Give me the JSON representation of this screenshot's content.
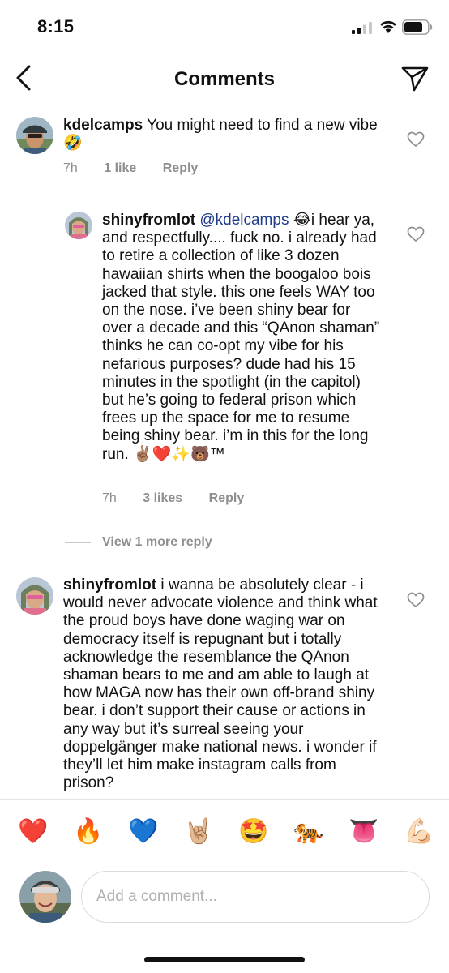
{
  "status": {
    "time": "8:15"
  },
  "header": {
    "title": "Comments"
  },
  "comments": [
    {
      "username": "kdelcamps",
      "text": "You might need to find a new vibe 🤣",
      "time": "7h",
      "likes": "1 like",
      "reply": "Reply"
    },
    {
      "username": "shinyfromlot",
      "mention": "@kdelcamps",
      "text": "😂i hear ya, and respectfully.... fuck no. i already had to retire a collection of like 3 dozen hawaiian shirts when the boogaloo bois jacked that style. this one feels WAY too on the nose. i’ve been shiny bear for over a decade and this “QAnon shaman” thinks he can co-opt my vibe for his nefarious purposes? dude had his 15 minutes in the spotlight (in the capitol) but he’s going to federal prison which frees up the space for me to resume being shiny bear. i’m in this for the long run. ✌🏽❤️✨🐻™",
      "time": "7h",
      "likes": "3 likes",
      "reply": "Reply"
    },
    {
      "username": "shinyfromlot",
      "text": "i wanna be absolutely clear - i would never advocate violence and think what the proud boys have done waging war on democracy itself is repugnant but i totally acknowledge the resemblance the QAnon shaman bears to me and am able to laugh at how MAGA now has their own off-brand shiny bear. i don’t support their cause or actions in any way but it’s surreal seeing your doppelgänger make national news. i wonder if they’ll let him make instagram calls from prison?"
    }
  ],
  "view_replies": "View 1 more reply",
  "emoji_bar": [
    {
      "glyph": "❤️",
      "name": "red-heart-emoji"
    },
    {
      "glyph": "🔥",
      "name": "fire-emoji"
    },
    {
      "glyph": "💙",
      "name": "blue-heart-emoji"
    },
    {
      "glyph": "🤘🏼",
      "name": "rock-on-emoji"
    },
    {
      "glyph": "🤩",
      "name": "star-struck-emoji"
    },
    {
      "glyph": "🐅",
      "name": "tiger-emoji"
    },
    {
      "glyph": "👅",
      "name": "tongue-emoji"
    },
    {
      "glyph": "💪🏻",
      "name": "flexed-biceps-emoji"
    }
  ],
  "composer": {
    "placeholder": "Add a comment..."
  },
  "colors": {
    "mention": "#1f3c8a",
    "meta": "#8e8e8e",
    "divider": "#e4e4e4"
  }
}
